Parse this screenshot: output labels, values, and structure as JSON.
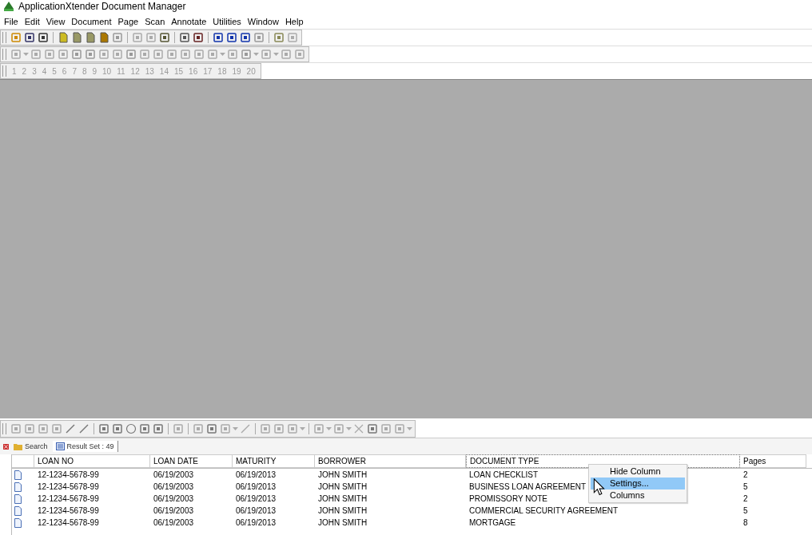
{
  "window": {
    "title": "ApplicationXtender Document Manager"
  },
  "menu": [
    "File",
    "Edit",
    "View",
    "Document",
    "Page",
    "Scan",
    "Annotate",
    "Utilities",
    "Window",
    "Help"
  ],
  "page_buttons": [
    "1",
    "2",
    "3",
    "4",
    "5",
    "6",
    "7",
    "8",
    "9",
    "10",
    "11",
    "12",
    "13",
    "14",
    "15",
    "16",
    "17",
    "18",
    "19",
    "20"
  ],
  "tabs": [
    {
      "label": "Search",
      "selected": false,
      "kind": "search"
    },
    {
      "label": "Result Set : 49",
      "selected": true,
      "kind": "results"
    }
  ],
  "table": {
    "columns": [
      "LOAN NO",
      "LOAN DATE",
      "MATURITY",
      "BORROWER",
      "DOCUMENT TYPE",
      "Pages"
    ],
    "rows": [
      [
        "12-1234-5678-99",
        "06/19/2003",
        "06/19/2013",
        "JOHN SMITH",
        "LOAN CHECKLIST",
        "2"
      ],
      [
        "12-1234-5678-99",
        "06/19/2003",
        "06/19/2013",
        "JOHN SMITH",
        "BUSINESS LOAN AGREEMENT",
        "5"
      ],
      [
        "12-1234-5678-99",
        "06/19/2003",
        "06/19/2013",
        "JOHN SMITH",
        "PROMISSORY NOTE",
        "2"
      ],
      [
        "12-1234-5678-99",
        "06/19/2003",
        "06/19/2013",
        "JOHN SMITH",
        "COMMERCIAL SECURITY AGREEMENT",
        "5"
      ],
      [
        "12-1234-5678-99",
        "06/19/2003",
        "06/19/2013",
        "JOHN SMITH",
        "MORTGAGE",
        "8"
      ]
    ]
  },
  "context_menu": [
    {
      "label": "Hide Column",
      "selected": false
    },
    {
      "label": "Settings...",
      "selected": true
    },
    {
      "label": "Columns",
      "selected": false
    }
  ]
}
